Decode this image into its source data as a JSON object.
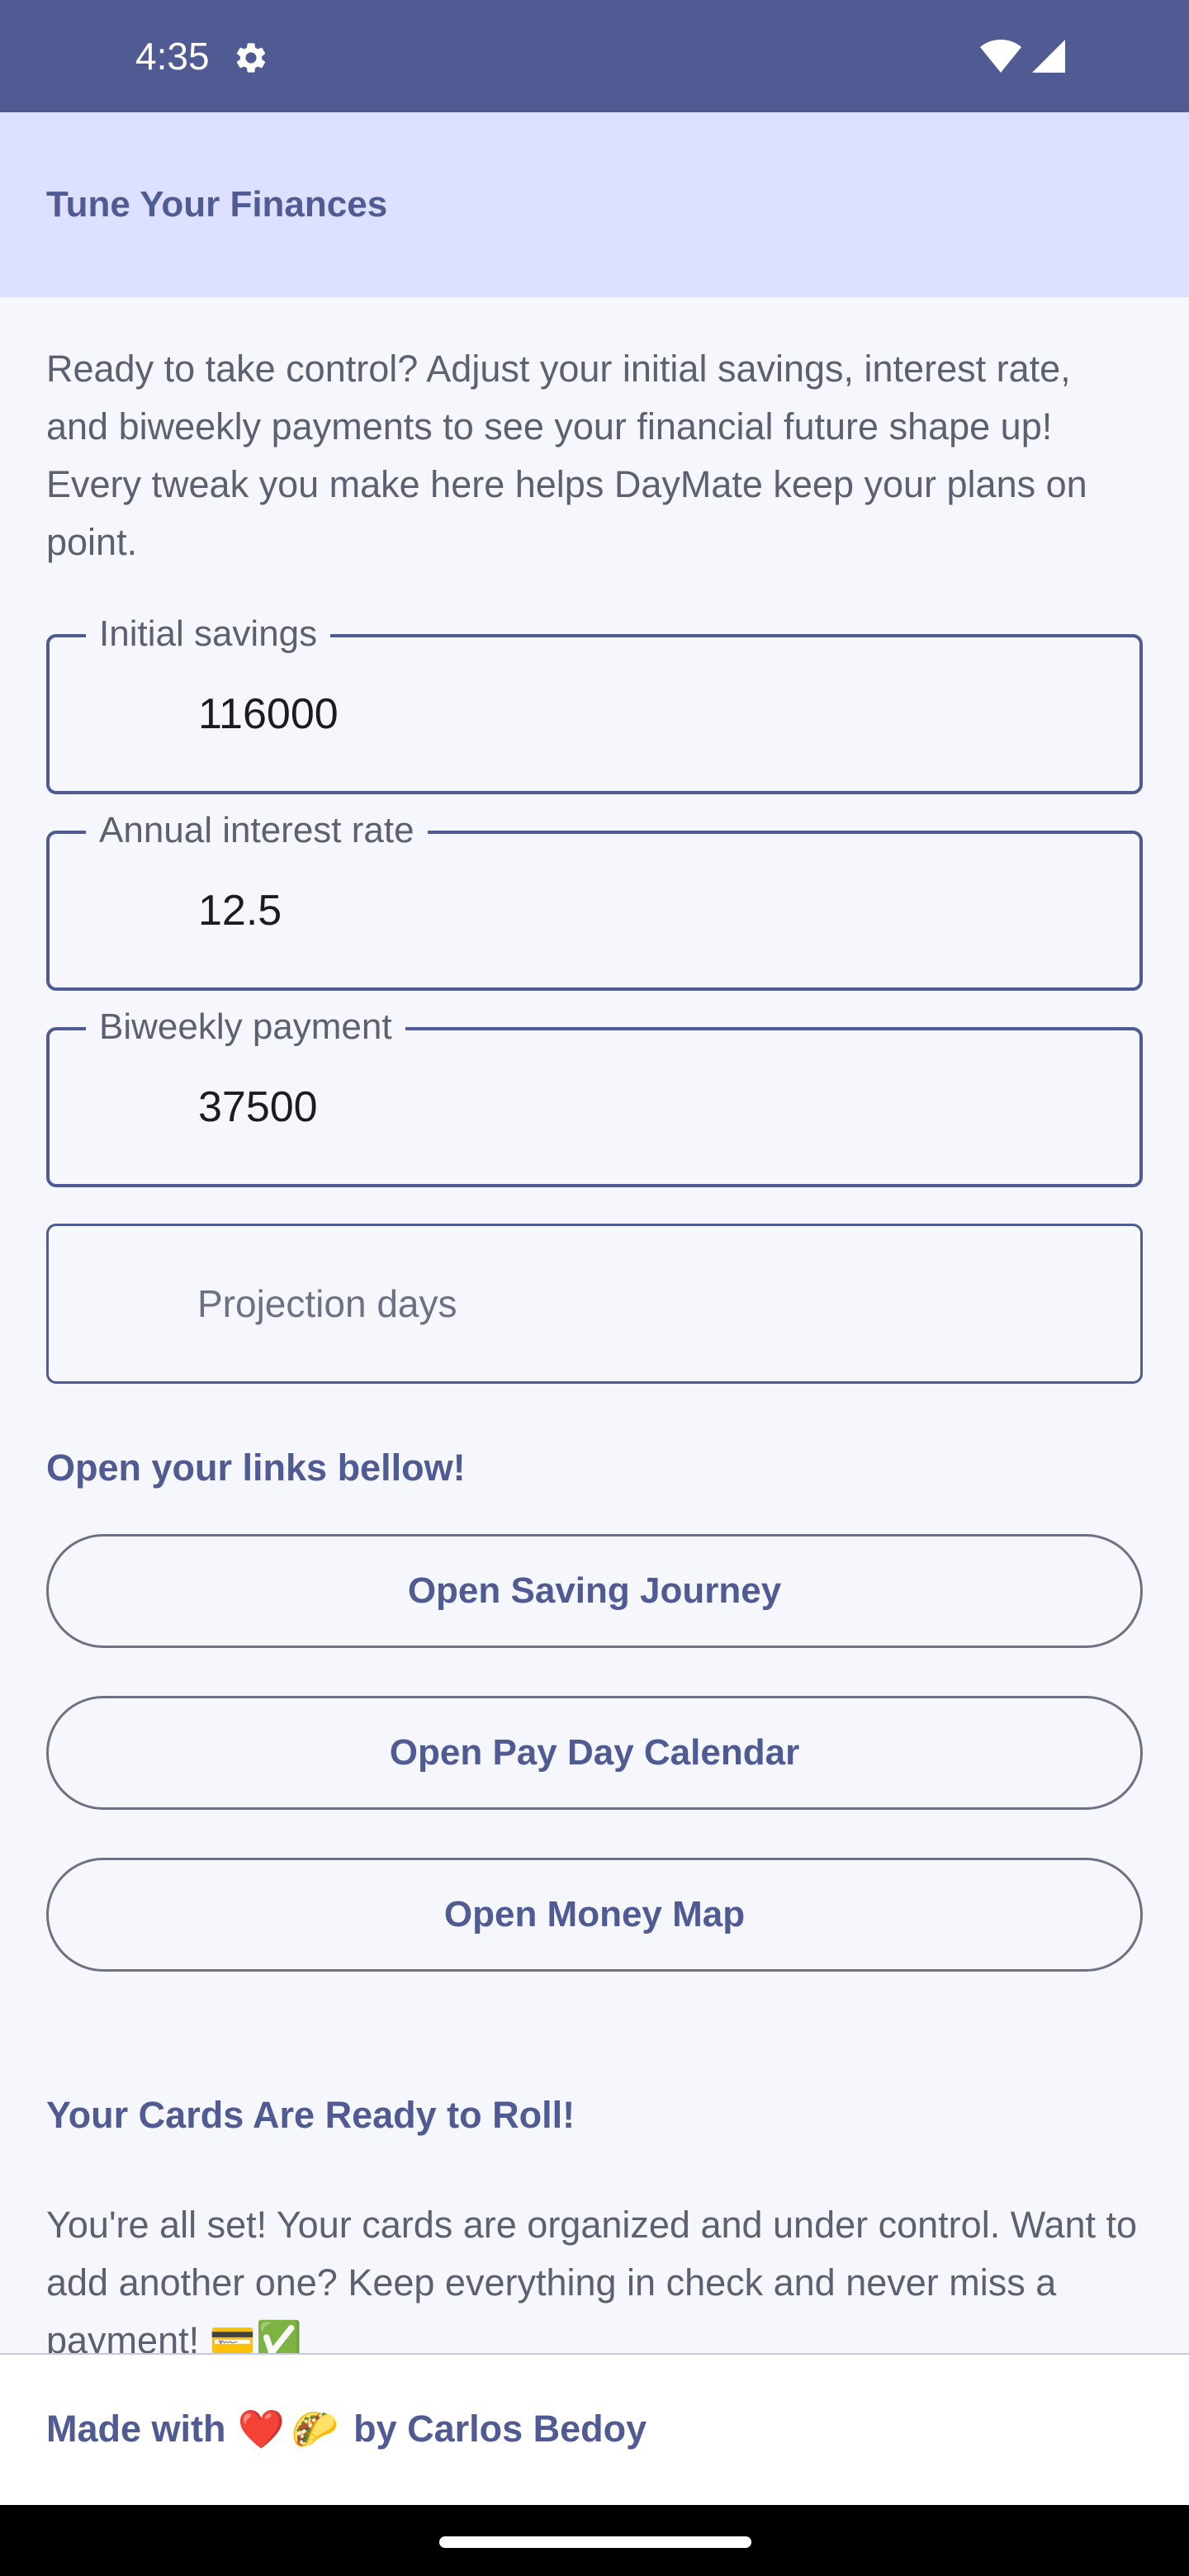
{
  "status_bar": {
    "time": "4:35",
    "icons": [
      "gear-icon",
      "wifi-icon",
      "signal-icon"
    ]
  },
  "app_bar": {
    "title": "Tune Your Finances"
  },
  "intro": {
    "text": "Ready to take control? Adjust your initial savings, interest rate, and biweekly payments to see your financial future shape up! Every tweak you make here helps DayMate keep your plans on point."
  },
  "fields": {
    "initial_savings": {
      "label": "Initial savings",
      "value": "116000"
    },
    "interest_rate": {
      "label": "Annual interest rate",
      "value": "12.5"
    },
    "biweekly_payment": {
      "label": "Biweekly payment",
      "value": "37500"
    },
    "projection_days": {
      "placeholder": "Projection days",
      "value": ""
    }
  },
  "links": {
    "heading": "Open your links bellow!",
    "buttons": [
      "Open Saving Journey",
      "Open Pay Day Calendar",
      "Open Money Map"
    ]
  },
  "cards": {
    "heading": "Your Cards Are Ready to Roll!",
    "text": "You're all set! Your cards are organized and under control. Want to add another one? Keep everything in check and never miss a payment! 💳✅"
  },
  "footer": {
    "made_with": "Made with",
    "emoji_heart": "❤️",
    "emoji_taco": "🌮",
    "by": "by Carlos Bedoy"
  },
  "colors": {
    "primary": "#4f5b92",
    "app_bar_bg": "#dde1ff",
    "background": "#f6f7fd",
    "text_secondary": "#5d6070"
  }
}
